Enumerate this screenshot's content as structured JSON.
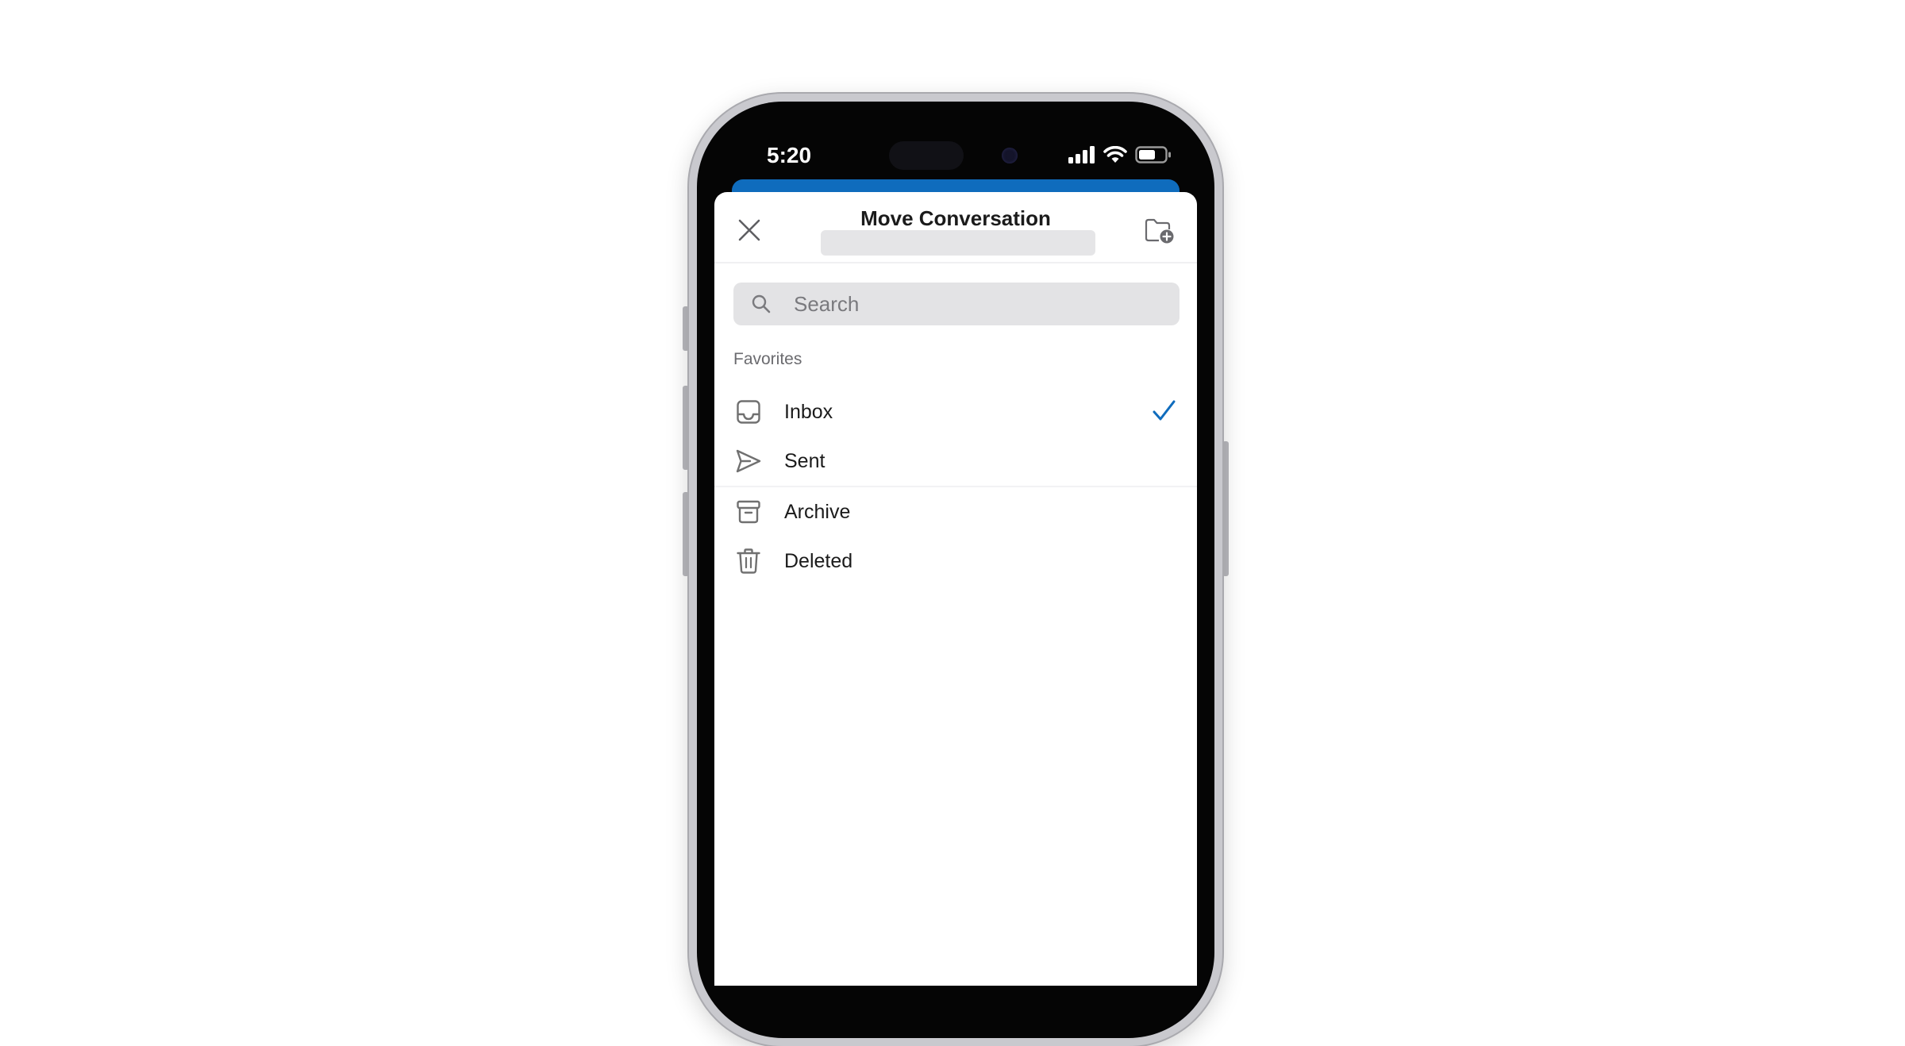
{
  "status_bar": {
    "time": "5:20"
  },
  "sheet": {
    "title": "Move Conversation",
    "search_placeholder": "Search",
    "section_label": "Favorites",
    "folders": [
      {
        "label": "Inbox",
        "icon": "inbox-icon",
        "selected": true
      },
      {
        "label": "Sent",
        "icon": "send-icon",
        "selected": false
      },
      {
        "label": "Archive",
        "icon": "archive-icon",
        "selected": false
      },
      {
        "label": "Deleted",
        "icon": "trash-icon",
        "selected": false
      }
    ]
  },
  "colors": {
    "accent": "#0f6cbd",
    "check": "#0f6cbd",
    "icon": "#707070"
  }
}
